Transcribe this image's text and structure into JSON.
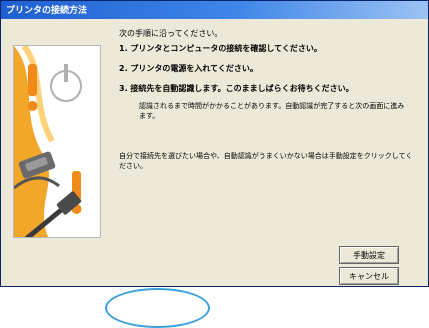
{
  "window": {
    "title": "プリンタの接続方法"
  },
  "content": {
    "intro": "次の手順に沿ってください。",
    "steps": [
      "1. プリンタとコンピュータの接続を確認してください。",
      "2. プリンタの電源を入れてください。",
      "3. 接続先を自動認識します。このまましばらくお待ちください。"
    ],
    "note1": "認識されるまで時間がかかることがあります。自動認識が完了すると次の画面に進みます。",
    "note2": "自分で接続先を選びたい場合や、自動認識がうまくいかない場合は手動設定をクリックしてください。"
  },
  "buttons": {
    "manual": "手動設定",
    "cancel": "キャンセル"
  },
  "icons": {
    "power": "power-icon",
    "warning": "exclamation-icon",
    "cable": "usb-cable-icon"
  },
  "colors": {
    "title_bar": "#1f5fd1",
    "warning": "#f0a020",
    "accent_arc": "#3aa0e0"
  }
}
